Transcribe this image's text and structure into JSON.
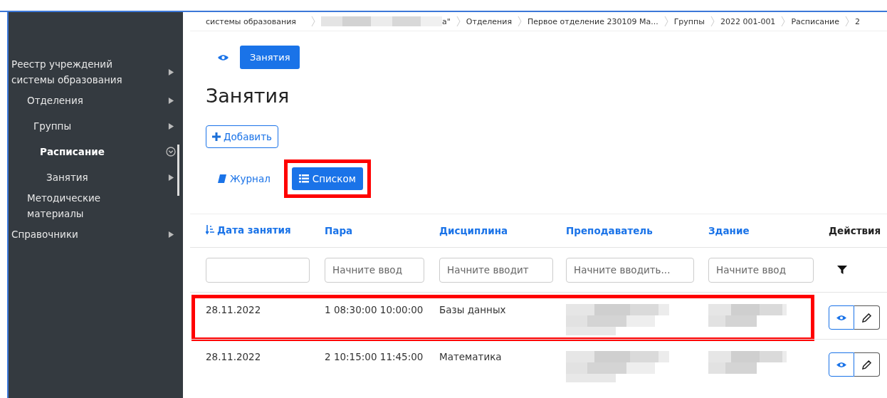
{
  "sidebar": {
    "items": [
      {
        "label": "Реестр учреждений системы образования",
        "expandable": true,
        "expanded": false,
        "selected": false,
        "children": [
          {
            "label": "Отделения",
            "expandable": true,
            "expanded": false,
            "selected": false,
            "children": [
              {
                "label": "Группы",
                "expandable": true,
                "expanded": false,
                "selected": false,
                "children": [
                  {
                    "label": "Расписание",
                    "expandable": true,
                    "expanded": true,
                    "selected": true,
                    "children": [
                      {
                        "label": "Занятия",
                        "expandable": true,
                        "expanded": false,
                        "selected": false
                      }
                    ]
                  }
                ]
              }
            ]
          },
          {
            "label": "Методические материалы",
            "expandable": false,
            "selected": false
          }
        ]
      },
      {
        "label": "Справочники",
        "expandable": true,
        "expanded": false,
        "selected": false
      }
    ]
  },
  "breadcrumbs": [
    {
      "label": "системы образования"
    },
    {
      "kind": "blurred",
      "label": "а\""
    },
    {
      "label": "Отделения"
    },
    {
      "label": "Первое отделение 230109 Ма..."
    },
    {
      "label": "Группы"
    },
    {
      "label": "2022 001-001"
    },
    {
      "label": "Расписание"
    },
    {
      "label": "2"
    }
  ],
  "tabs": [
    {
      "kind": "icon",
      "selected": false
    },
    {
      "label": "Занятия",
      "selected": true
    }
  ],
  "page_title": "Занятия",
  "add_button": "Добавить",
  "view_buttons": [
    {
      "label": "Журнал",
      "selected": false,
      "highlighted": false
    },
    {
      "label": "Списком",
      "selected": true,
      "highlighted": true
    }
  ],
  "table": {
    "columns": [
      {
        "label": "Дата занятия",
        "sorted": true
      },
      {
        "label": "Пара",
        "sorted": false
      },
      {
        "label": "Дисциплина",
        "sorted": false
      },
      {
        "label": "Преподаватель",
        "sorted": false
      },
      {
        "label": "Здание",
        "sorted": false
      },
      {
        "label": "Действия",
        "sorted": false
      }
    ],
    "filters": [
      {
        "kind": "blank"
      },
      {
        "kind": "text",
        "placeholder": "Начните ввод"
      },
      {
        "kind": "text",
        "placeholder": "Начните вводит"
      },
      {
        "kind": "text",
        "placeholder": "Начните вводить..."
      },
      {
        "kind": "text",
        "placeholder": "Начните ввод"
      }
    ],
    "rows": [
      {
        "date": "28.11.2022",
        "pair": "1 08:30:00 10:00:00",
        "discipline": "Базы данных",
        "highlighted": true
      },
      {
        "date": "28.11.2022",
        "pair": "2 10:15:00 11:45:00",
        "discipline": "Математика",
        "highlighted": false
      }
    ]
  }
}
